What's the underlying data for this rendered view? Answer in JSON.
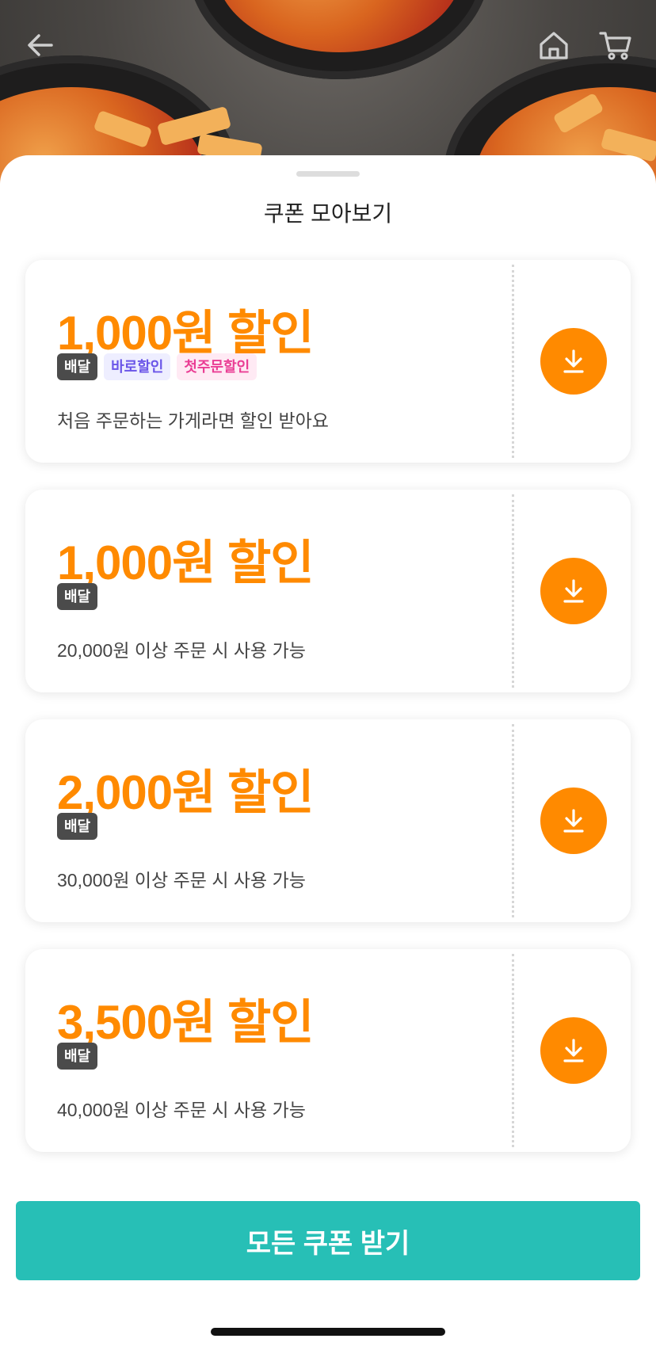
{
  "header": {
    "back_icon": "arrow-left-icon",
    "home_icon": "home-icon",
    "cart_icon": "cart-icon"
  },
  "sheet": {
    "title": "쿠폰 모아보기"
  },
  "coupons": [
    {
      "amount": "1,000원 할인",
      "tags": {
        "delivery": "배달",
        "instant": "바로할인",
        "first": "첫주문할인"
      },
      "description": "처음 주문하는 가게라면 할인 받아요"
    },
    {
      "amount": "1,000원 할인",
      "tags": {
        "delivery": "배달"
      },
      "description": "20,000원 이상 주문 시 사용 가능"
    },
    {
      "amount": "2,000원 할인",
      "tags": {
        "delivery": "배달"
      },
      "description": "30,000원 이상 주문 시 사용 가능"
    },
    {
      "amount": "3,500원 할인",
      "tags": {
        "delivery": "배달"
      },
      "description": "40,000원 이상 주문 시 사용 가능"
    }
  ],
  "cta": {
    "label": "모든 쿠폰 받기"
  },
  "colors": {
    "accent": "#ff8a00",
    "cta": "#27bfb6",
    "tag_delivery": "#4b4b4b",
    "tag_instant": "#6a55e8",
    "tag_first": "#ea3d94"
  }
}
